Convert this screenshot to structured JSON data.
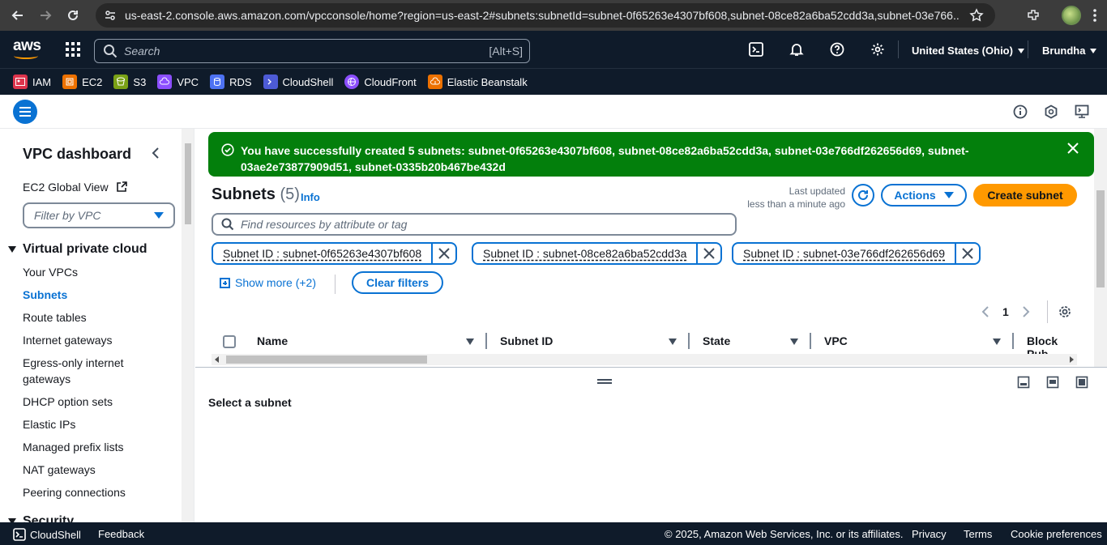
{
  "browser": {
    "url": "us-east-2.console.aws.amazon.com/vpcconsole/home?region=us-east-2#subnets:subnetId=subnet-0f65263e4307bf608,subnet-08ce82a6ba52cdd3a,subnet-03e766..."
  },
  "header": {
    "logo": "aws",
    "search_placeholder": "Search",
    "search_shortcut": "[Alt+S]",
    "region": "United States (Ohio)",
    "account": "Brundha"
  },
  "favorites": [
    {
      "label": "IAM",
      "color": "#dd344c"
    },
    {
      "label": "EC2",
      "color": "#ed7100"
    },
    {
      "label": "S3",
      "color": "#7aa116"
    },
    {
      "label": "VPC",
      "color": "#8c4fff"
    },
    {
      "label": "RDS",
      "color": "#4d72f3"
    },
    {
      "label": "CloudShell",
      "color": "#4d5bd6"
    },
    {
      "label": "CloudFront",
      "color": "#8c4fff"
    },
    {
      "label": "Elastic Beanstalk",
      "color": "#ed7100"
    }
  ],
  "sidebar": {
    "title": "VPC dashboard",
    "global_view": "EC2 Global View",
    "filter_placeholder": "Filter by VPC",
    "section": "Virtual private cloud",
    "items": [
      "Your VPCs",
      "Subnets",
      "Route tables",
      "Internet gateways",
      "Egress-only internet",
      "gateways",
      "DHCP option sets",
      "Elastic IPs",
      "Managed prefix lists",
      "NAT gateways",
      "Peering connections"
    ],
    "next_section": "Security",
    "active": "Subnets"
  },
  "flash": {
    "message_line1": "You have successfully created 5 subnets: subnet-0f65263e4307bf608, subnet-08ce82a6ba52cdd3a, subnet-03e766df262656d69, subnet-",
    "message_line2": "03ae2e73877909d51, subnet-0335b20b467be432d",
    "color": "#037f0c"
  },
  "main": {
    "title": "Subnets",
    "count": "(5)",
    "info": "Info",
    "last_updated_label": "Last updated",
    "last_updated_value": "less than a minute ago",
    "actions": "Actions",
    "create": "Create subnet",
    "find_placeholder": "Find resources by attribute or tag",
    "tokens": [
      "Subnet ID : subnet-0f65263e4307bf608",
      "Subnet ID : subnet-08ce82a6ba52cdd3a",
      "Subnet ID : subnet-03e766df262656d69"
    ],
    "show_more": "Show more (+2)",
    "clear_filters": "Clear filters",
    "page": "1",
    "columns": [
      "Name",
      "Subnet ID",
      "State",
      "VPC",
      "Block Pub"
    ]
  },
  "split_panel": {
    "title": "Select a subnet"
  },
  "footer": {
    "cloudshell": "CloudShell",
    "feedback": "Feedback",
    "copyright": "© 2025, Amazon Web Services, Inc. or its affiliates.",
    "privacy": "Privacy",
    "terms": "Terms",
    "cookies": "Cookie preferences"
  }
}
